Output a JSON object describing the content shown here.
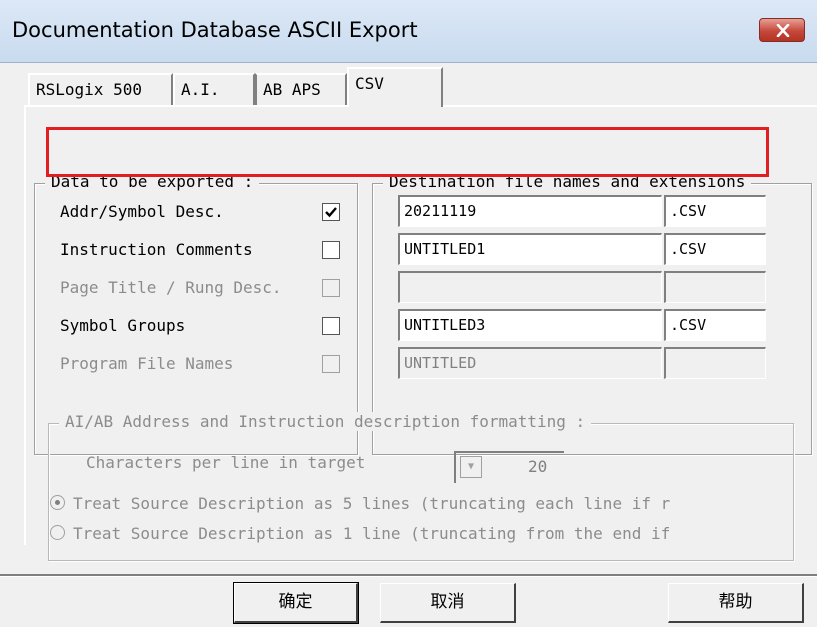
{
  "window": {
    "title": "Documentation Database ASCII Export",
    "close_icon": "close-icon"
  },
  "tabs": [
    {
      "label": "RSLogix 500"
    },
    {
      "label": "A.I."
    },
    {
      "label": "AB APS"
    },
    {
      "label": "CSV"
    }
  ],
  "data_group": {
    "title": "Data to be exported  :",
    "items": [
      {
        "label": "Addr/Symbol Desc.",
        "checked": true,
        "enabled": true
      },
      {
        "label": "Instruction Comments",
        "checked": false,
        "enabled": true
      },
      {
        "label": "Page Title / Rung Desc.",
        "checked": false,
        "enabled": false
      },
      {
        "label": "Symbol Groups",
        "checked": false,
        "enabled": true
      },
      {
        "label": "Program File Names",
        "checked": false,
        "enabled": false
      }
    ]
  },
  "dest_group": {
    "title": "Destination file names and extensions",
    "rows": [
      {
        "name": "20211119",
        "ext": ".CSV",
        "enabled": true
      },
      {
        "name": "UNTITLED1",
        "ext": ".CSV",
        "enabled": true
      },
      {
        "name": "",
        "ext": "",
        "enabled": false
      },
      {
        "name": "UNTITLED3",
        "ext": ".CSV",
        "enabled": true
      },
      {
        "name": "UNTITLED",
        "ext": "",
        "enabled": false
      }
    ]
  },
  "format_group": {
    "title": "AI/AB Address and Instruction description formatting :",
    "chars_label": "Characters per line in target",
    "chars_value": "20",
    "radio1": "Treat Source Description as 5 lines (truncating each line if r",
    "radio2": "Treat Source Description as 1 line (truncating from the end if",
    "radio1_selected": true
  },
  "buttons": {
    "ok": "确定",
    "cancel": "取消",
    "help": "帮助"
  },
  "colors": {
    "highlight": "#e02020",
    "close_button": "#c6473b"
  }
}
